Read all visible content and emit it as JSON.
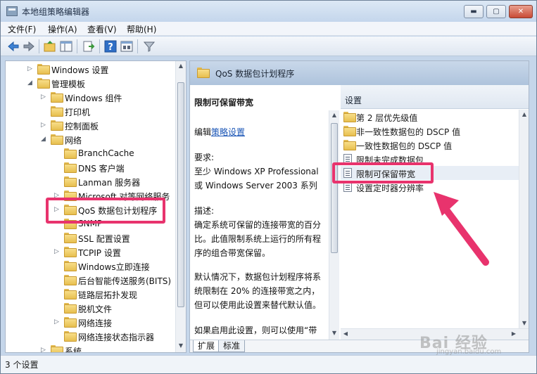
{
  "window": {
    "title": "本地组策略编辑器",
    "min": "▬",
    "max": "▢",
    "close": "✕"
  },
  "menu": [
    "文件(F)",
    "操作(A)",
    "查看(V)",
    "帮助(H)"
  ],
  "toolbar": [
    "back-icon",
    "forward-icon",
    "folder-up-icon",
    "show-hide-tree-icon",
    "export-list-icon",
    "help-icon",
    "properties-icon",
    "filter-icon"
  ],
  "tree": {
    "items": [
      {
        "label": "Windows 设置",
        "expander": "▷"
      },
      {
        "label": "管理模板",
        "expander": "◢"
      },
      {
        "label": "Windows 组件",
        "expander": "▷"
      },
      {
        "label": "打印机",
        "expander": ""
      },
      {
        "label": "控制面板",
        "expander": "▷"
      },
      {
        "label": "网络",
        "expander": "◢"
      },
      {
        "label": "BranchCache",
        "expander": ""
      },
      {
        "label": "DNS 客户端",
        "expander": ""
      },
      {
        "label": "Lanman 服务器",
        "expander": ""
      },
      {
        "label": "Microsoft 对等网络服务",
        "expander": "▷"
      },
      {
        "label": "QoS 数据包计划程序",
        "expander": "▷"
      },
      {
        "label": "SNMP",
        "expander": ""
      },
      {
        "label": "SSL 配置设置",
        "expander": ""
      },
      {
        "label": "TCPIP 设置",
        "expander": "▷"
      },
      {
        "label": "Windows立即连接",
        "expander": ""
      },
      {
        "label": "后台智能传送服务(BITS)",
        "expander": ""
      },
      {
        "label": "链路层拓扑发现",
        "expander": ""
      },
      {
        "label": "脱机文件",
        "expander": ""
      },
      {
        "label": "网络连接",
        "expander": "▷"
      },
      {
        "label": "网络连接状态指示器",
        "expander": ""
      },
      {
        "label": "系统",
        "expander": "▷"
      }
    ]
  },
  "right": {
    "header": "QoS 数据包计划程序",
    "description": {
      "title": "限制可保留带宽",
      "edit_prefix": "编辑",
      "edit_link": "策略设置",
      "requirements_label": "要求:",
      "requirements_1": "至少 Windows XP Professional",
      "requirements_2": "或 Windows Server 2003 系列",
      "desc_label": "描述:",
      "desc_1": "确定系统可保留的连接带宽的百分",
      "desc_2": "比。此值限制系统上运行的所有程",
      "desc_3": "序的组合带宽保留。",
      "desc_4": "默认情况下，数据包计划程序将系",
      "desc_5": "统限制在 20% 的连接带宽之内，",
      "desc_6": "但可以使用此设置来替代默认值。",
      "desc_7": "如果启用此设置，则可以使用“带"
    },
    "list_header": "设置",
    "items": [
      {
        "label": "第 2 层优先级值",
        "type": "folder"
      },
      {
        "label": "非一致性数据包的 DSCP 值",
        "type": "folder"
      },
      {
        "label": "一致性数据包的 DSCP 值",
        "type": "folder"
      },
      {
        "label": "限制未完成数据包",
        "type": "setting"
      },
      {
        "label": "限制可保留带宽",
        "type": "setting"
      },
      {
        "label": "设置定时器分辨率",
        "type": "setting"
      }
    ],
    "tabs": [
      "扩展",
      "标准"
    ]
  },
  "status": "3 个设置",
  "watermark": {
    "main": "Bai 经验",
    "sub": "jingyan.baidu.com"
  },
  "colors": {
    "highlight": "#e8336d",
    "link": "#1a55b6"
  }
}
